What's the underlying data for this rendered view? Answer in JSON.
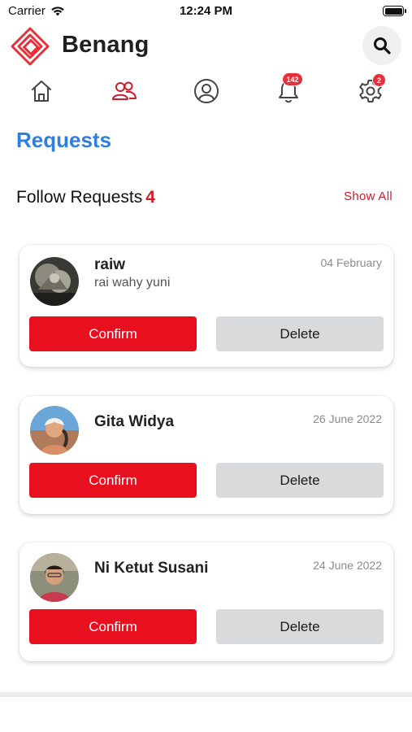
{
  "status_bar": {
    "carrier": "Carrier",
    "time": "12:24 PM"
  },
  "header": {
    "app_name": "Benang",
    "logo_icon": "benang-logo-icon",
    "search_icon": "search-icon"
  },
  "nav": {
    "items": [
      {
        "name": "home",
        "icon": "home-icon"
      },
      {
        "name": "friends",
        "icon": "users-icon",
        "active": true
      },
      {
        "name": "profile",
        "icon": "profile-icon"
      },
      {
        "name": "notifications",
        "icon": "bell-icon",
        "badge": "142"
      },
      {
        "name": "settings",
        "icon": "gear-icon",
        "badge": "2"
      }
    ]
  },
  "page": {
    "title": "Requests"
  },
  "follow_requests": {
    "label": "Follow Requests",
    "count": "4",
    "show_all": "Show All",
    "items": [
      {
        "name": "raiw",
        "subtitle": "rai wahy yuni",
        "date": "04 February",
        "confirm": "Confirm",
        "delete": "Delete"
      },
      {
        "name": "Gita Widya",
        "subtitle": "",
        "date": "26 June 2022",
        "confirm": "Confirm",
        "delete": "Delete"
      },
      {
        "name": "Ni Ketut Susani",
        "subtitle": "",
        "date": "24 June 2022",
        "confirm": "Confirm",
        "delete": "Delete"
      }
    ]
  },
  "colors": {
    "accent_red": "#e8101f",
    "title_blue": "#2f7fe0",
    "badge_red": "#e8303a"
  }
}
